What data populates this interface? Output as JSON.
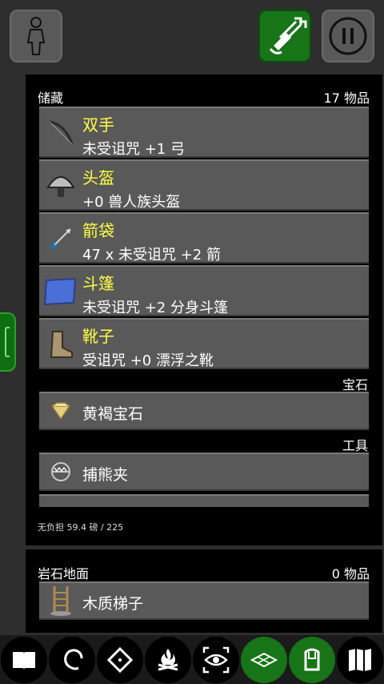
{
  "top_buttons": {
    "character": "person-icon",
    "quiver": "quiver-arrows-icon",
    "pause": "pause-icon"
  },
  "inventory": {
    "header": "储藏",
    "count": "17 物品",
    "equipped": [
      {
        "name": "双手",
        "desc": "未受诅咒 +1 弓",
        "icon": "bow-icon"
      },
      {
        "name": "头盔",
        "desc": "+0 兽人族头盔",
        "icon": "helmet-icon"
      },
      {
        "name": "箭袋",
        "desc": "47 x 未受诅咒 +2 箭",
        "icon": "arrow-icon"
      },
      {
        "name": "斗篷",
        "desc": "未受诅咒 +2 分身斗篷",
        "icon": "cloak-icon"
      },
      {
        "name": "靴子",
        "desc": "受诅咒 +0 漂浮之靴",
        "icon": "boots-icon"
      }
    ],
    "gem_section": "宝石",
    "gem_item": "黄褐宝石",
    "tool_section": "工具",
    "tool_item": "捕熊夹",
    "weight": "无负担 59.4 磅 / 225"
  },
  "ground": {
    "header": "岩石地面",
    "count": "0 物品",
    "item": "木质梯子"
  },
  "toolbar": {
    "items": [
      "book-icon",
      "talk-icon",
      "rune-icon",
      "campfire-icon",
      "search-eye-icon",
      "floor-icon",
      "inventory-icon",
      "map-icon"
    ],
    "active": [
      "floor-icon",
      "inventory-icon"
    ]
  },
  "colors": {
    "accent": "#177417",
    "item_name": "#ffff44",
    "slot": "#595959",
    "panel": "#000000"
  }
}
